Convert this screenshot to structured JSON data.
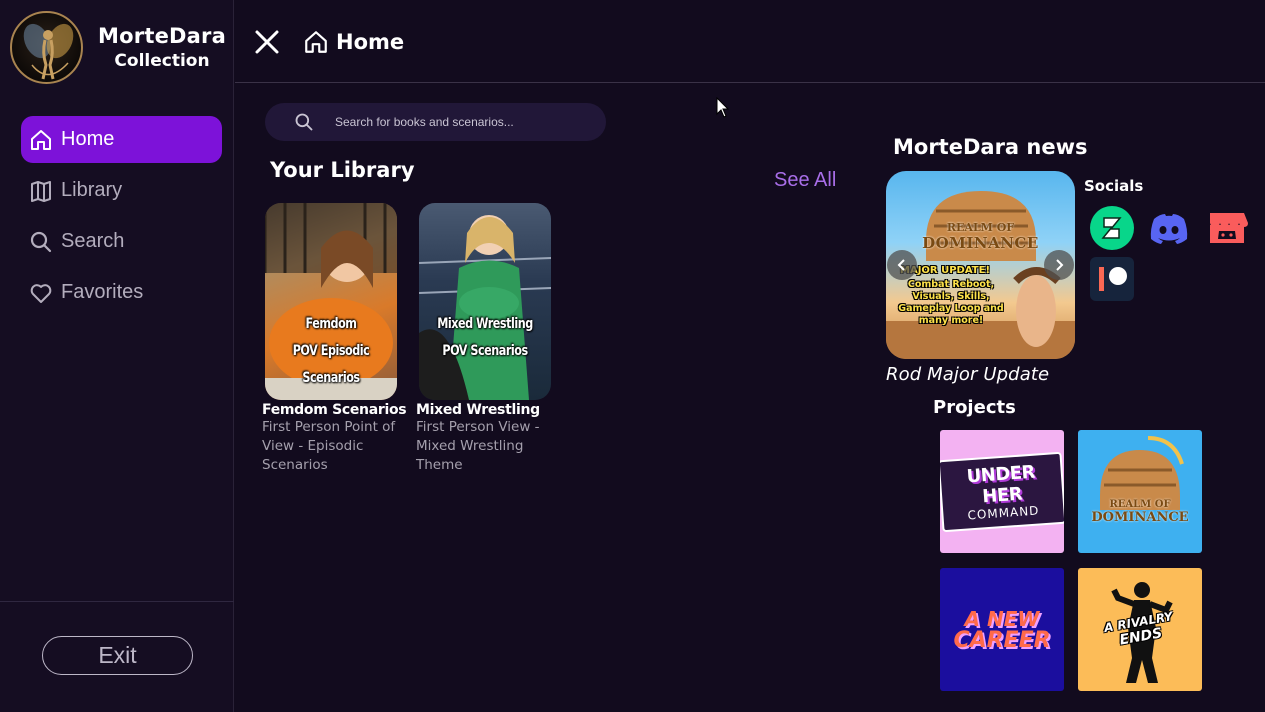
{
  "sidebar": {
    "brand_line1": "MorteDara",
    "brand_line2": "Collection",
    "items": [
      {
        "label": "Home",
        "icon": "home-icon",
        "active": true
      },
      {
        "label": "Library",
        "icon": "library-icon"
      },
      {
        "label": "Search",
        "icon": "search-icon"
      },
      {
        "label": "Favorites",
        "icon": "heart-icon"
      }
    ],
    "exit_label": "Exit"
  },
  "header": {
    "title": "Home"
  },
  "search": {
    "placeholder": "Search for books and scenarios..."
  },
  "library": {
    "title": "Your Library",
    "see_all": "See All",
    "books": [
      {
        "cover_line1": "Femdom",
        "cover_line2": "POV Episodic Scenarios",
        "title": "Femdom Scenarios",
        "description": "First Person Point of View - Episodic Scenarios"
      },
      {
        "cover_line1": "Mixed Wrestling",
        "cover_line2": "POV Scenarios",
        "title": "Mixed Wrestling",
        "description": "First Person View - Mixed Wrestling Theme"
      }
    ]
  },
  "news": {
    "title": "MorteDara news",
    "slide": {
      "logo_line1": "REALM OF",
      "logo_line2": "DOMINANCE",
      "headline": "MAJOR UPDATE!",
      "body": "Combat Reboot, Visuals, Skills, Gameplay Loop and many more!",
      "caption": "Rod Major Update"
    }
  },
  "socials": {
    "title": "Socials",
    "icons": [
      "deviantart-icon",
      "discord-icon",
      "itchio-icon",
      "patreon-icon"
    ]
  },
  "projects": {
    "title": "Projects",
    "items": [
      {
        "line1": "UNDER HER",
        "line2": "COMMAND",
        "bg": "#f3b2f2"
      },
      {
        "line1": "REALM OF",
        "line2": "DOMINANCE",
        "bg": "#3eb0f0"
      },
      {
        "line1": "A NEW",
        "line2": "CAREER",
        "bg": "#1b0e9e"
      },
      {
        "line1": "A RIVALRY",
        "line2": "ENDS",
        "bg": "#fcbc58"
      }
    ]
  },
  "colors": {
    "accent": "#7d12d9",
    "link": "#a86ee8",
    "background": "#120b1e"
  }
}
